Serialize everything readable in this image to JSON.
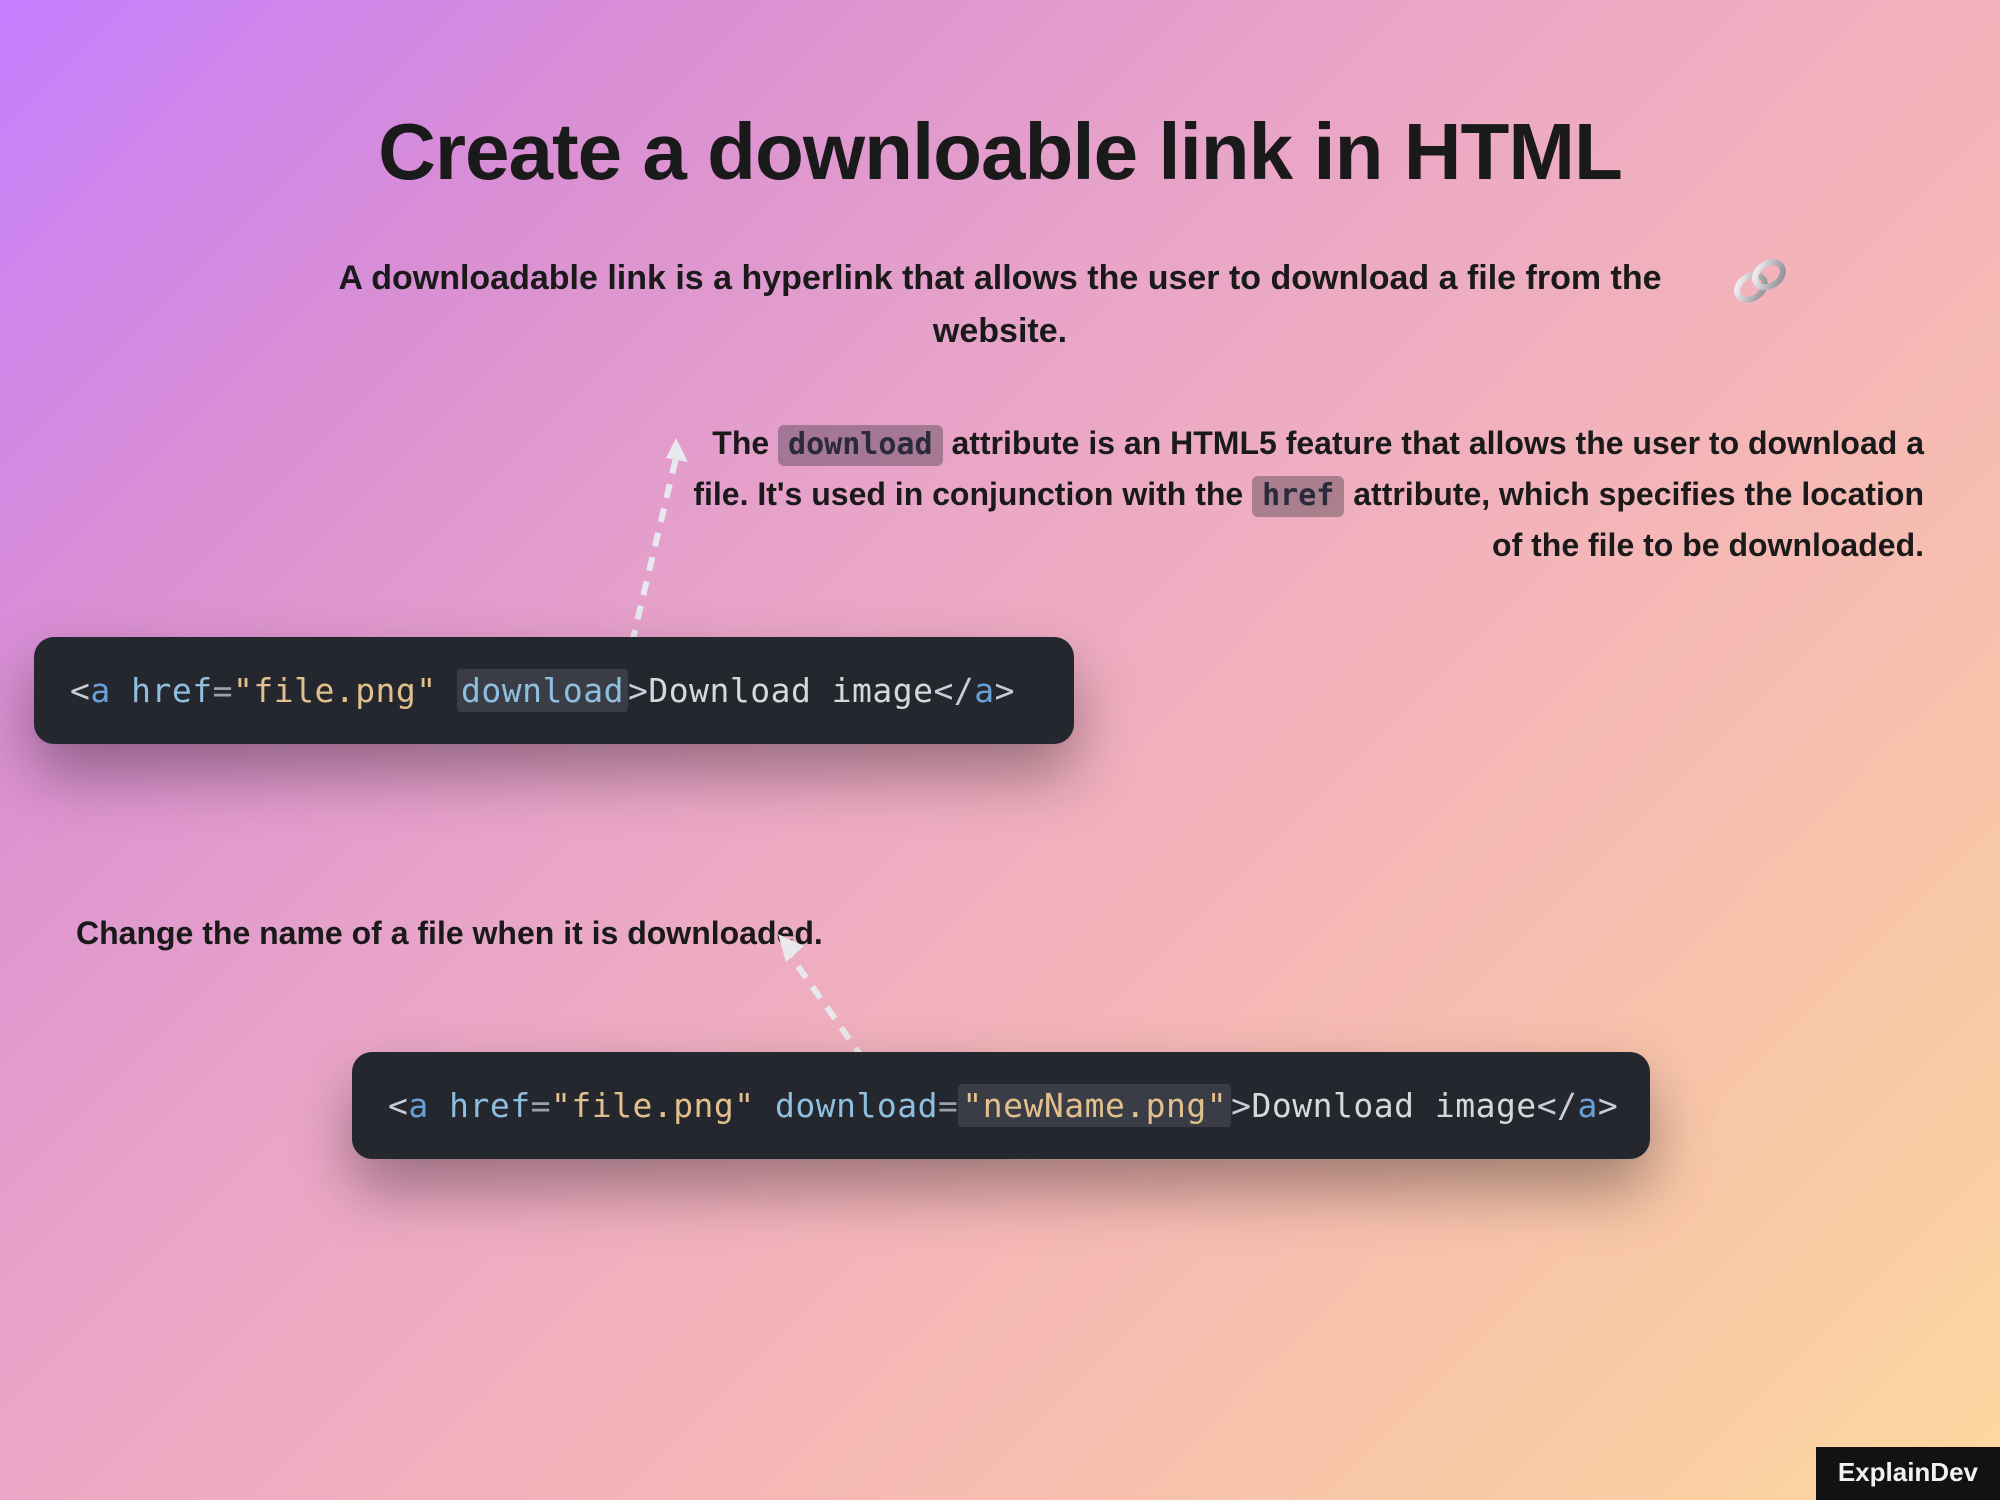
{
  "title": "Create a downloable link in HTML",
  "subtitle": "A downloadable link is a hyperlink that allows the user to download a file from the website.",
  "link_icon": "link-icon",
  "desc": {
    "t1": "The ",
    "code1": "download",
    "t2": " attribute is an HTML5 feature that allows the user to download a file. It's used in conjunction with the ",
    "code2": "href",
    "t3": " attribute, which specifies the location of the file to be downloaded."
  },
  "code1": {
    "open": "<",
    "tag": "a",
    "sp": " ",
    "attr_href": "href",
    "eq": "=",
    "val_href": "\"file.png\"",
    "attr_dl": "download",
    "gt": ">",
    "text": "Download image",
    "close_open": "</",
    "close_tag": "a",
    "close_gt": ">"
  },
  "caption2": "Change the name of a file when it is downloaded.",
  "code2": {
    "open": "<",
    "tag": "a",
    "sp": " ",
    "attr_href": "href",
    "eq": "=",
    "val_href": "\"file.png\"",
    "attr_dl": "download",
    "val_dl": "\"newName.png\"",
    "gt": ">",
    "text": "Download image",
    "close_open": "</",
    "close_tag": "a",
    "close_gt": ">"
  },
  "brand": "ExplainDev"
}
